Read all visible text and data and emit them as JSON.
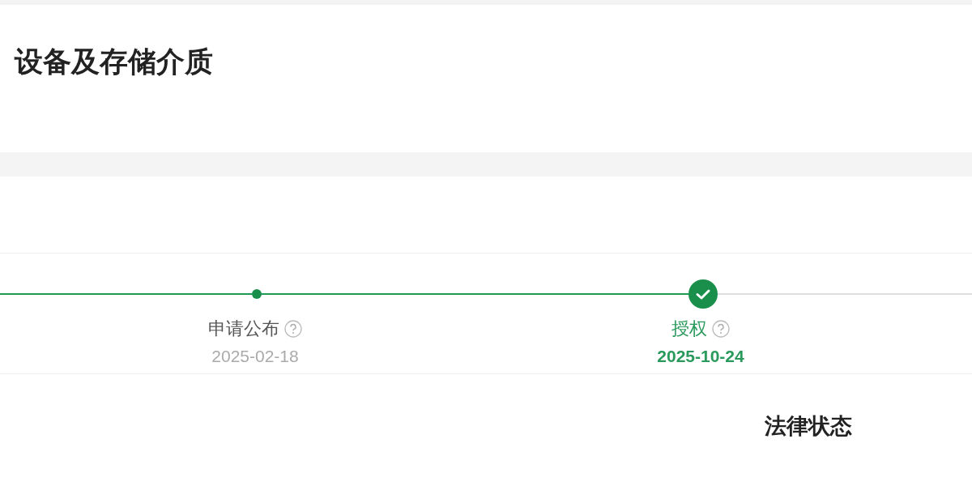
{
  "title": "设备及存储介质",
  "timeline": [
    {
      "label": "申请公布",
      "date": "2025-02-18",
      "reached": true,
      "current": false
    },
    {
      "label": "授权",
      "date": "2025-10-24",
      "reached": true,
      "current": true
    }
  ],
  "section_heading": "法律状态"
}
